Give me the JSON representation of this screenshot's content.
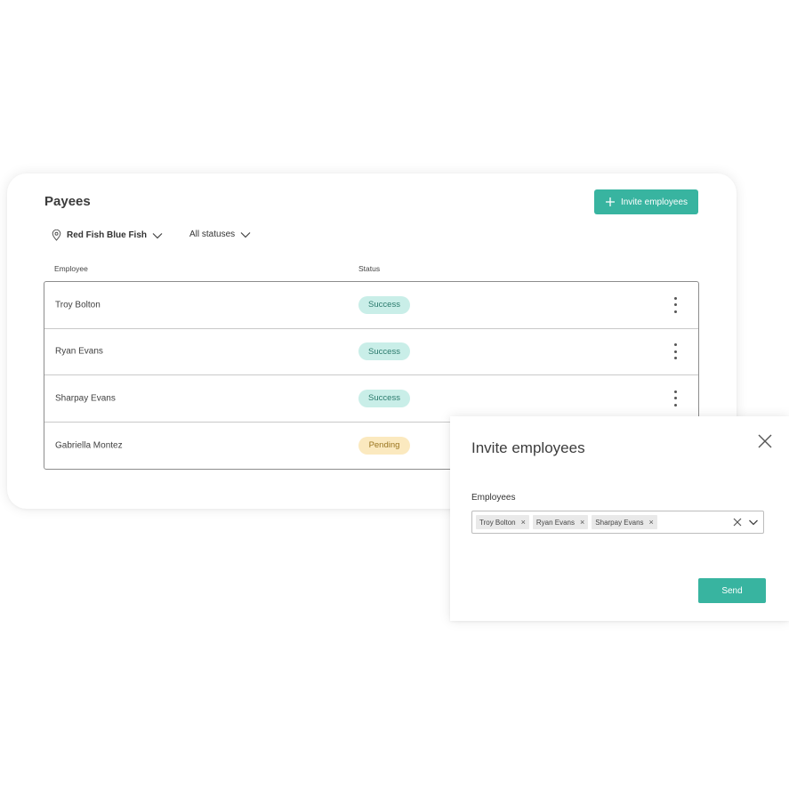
{
  "payees": {
    "title": "Payees",
    "invite_button_label": "Invite employees",
    "filters": {
      "location": "Red Fish Blue Fish",
      "status": "All statuses"
    },
    "columns": [
      "Employee",
      "Status"
    ],
    "rows": [
      {
        "name": "Troy Bolton",
        "status": "Success"
      },
      {
        "name": "Ryan Evans",
        "status": "Success"
      },
      {
        "name": "Sharpay Evans",
        "status": "Success"
      },
      {
        "name": "Gabriella Montez",
        "status": "Pending"
      }
    ]
  },
  "invite_modal": {
    "title": "Invite employees",
    "field_label": "Employees",
    "selected": [
      "Troy Bolton",
      "Ryan Evans",
      "Sharpay Evans"
    ],
    "tag_remove_glyph": "×",
    "send_label": "Send"
  },
  "colors": {
    "accent": "#38b4a0",
    "success_bg": "#c9eee8",
    "pending_bg": "#fbe9bf"
  },
  "icons": {
    "invite": "plus-icon",
    "location": "map-pin-icon",
    "dropdown": "chevron-down-icon",
    "row_menu": "more-vertical-icon",
    "close": "close-icon",
    "clear": "clear-icon"
  }
}
